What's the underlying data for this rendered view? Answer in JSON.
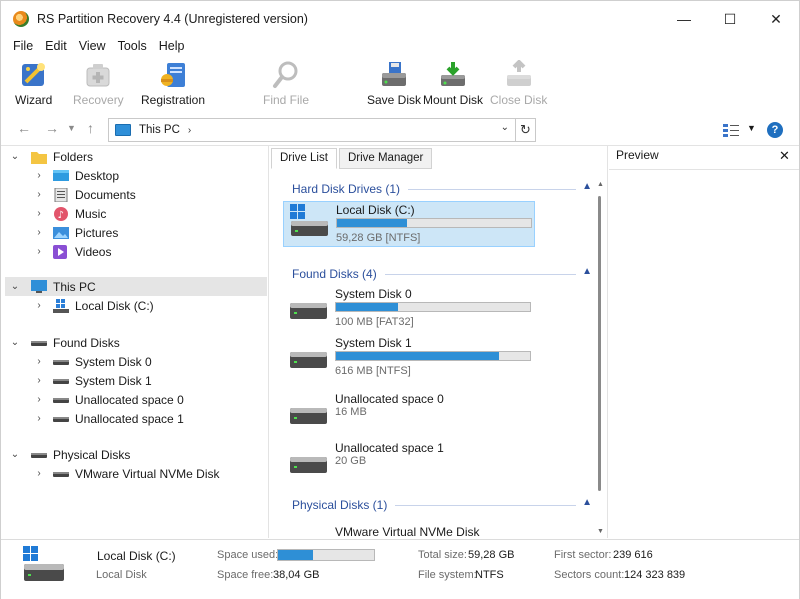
{
  "window": {
    "title": "RS Partition Recovery 4.4 (Unregistered version)",
    "controls": {
      "minimize": "—",
      "maximize": "☐",
      "close": "✕"
    }
  },
  "menu": [
    "File",
    "Edit",
    "View",
    "Tools",
    "Help"
  ],
  "toolbar": {
    "wizard": "Wizard",
    "recovery": "Recovery",
    "registration": "Registration",
    "find_file": "Find File",
    "save_disk": "Save Disk",
    "mount_disk": "Mount Disk",
    "close_disk": "Close Disk"
  },
  "address": {
    "path": "This PC",
    "separator": "›"
  },
  "tree": {
    "folders": "Folders",
    "desktop": "Desktop",
    "documents": "Documents",
    "music": "Music",
    "pictures": "Pictures",
    "videos": "Videos",
    "this_pc": "This PC",
    "local_disk": "Local Disk (C:)",
    "found_disks": "Found Disks",
    "system_disk_0": "System Disk 0",
    "system_disk_1": "System Disk 1",
    "unalloc_0": "Unallocated space 0",
    "unalloc_1": "Unallocated space 1",
    "physical_disks": "Physical Disks",
    "vmware": "VMware Virtual NVMe Disk"
  },
  "tabs": {
    "drive_list": "Drive List",
    "drive_manager": "Drive Manager"
  },
  "drive_list": {
    "hdd_section": "Hard Disk Drives (1)",
    "found_section": "Found Disks (4)",
    "physical_section": "Physical Disks (1)",
    "disks": [
      {
        "name": "Local Disk (C:)",
        "info": "59,28 GB [NTFS]",
        "used": 0.36
      },
      {
        "name": "System Disk 0",
        "info": "100 MB [FAT32]",
        "used": 0.32
      },
      {
        "name": "System Disk 1",
        "info": "616 MB [NTFS]",
        "used": 0.84
      },
      {
        "name": "Unallocated space 0",
        "info": "16 MB"
      },
      {
        "name": "Unallocated space 1",
        "info": "20 GB"
      },
      {
        "name": "VMware Virtual NVMe Disk"
      }
    ]
  },
  "preview": {
    "title": "Preview",
    "close": "✕"
  },
  "status": {
    "name": "Local Disk (C:)",
    "type": "Local Disk",
    "space_used_label": "Space used:",
    "space_used_fraction": 0.36,
    "space_free_label": "Space free:",
    "space_free": "38,04 GB",
    "total_size_label": "Total size:",
    "total_size": "59,28 GB",
    "file_system_label": "File system:",
    "file_system": "NTFS",
    "first_sector_label": "First sector:",
    "first_sector": "239 616",
    "sectors_count_label": "Sectors count:",
    "sectors_count": "124 323 839"
  },
  "colors": {
    "accent": "#2e8fd6",
    "section": "#2b4f9c",
    "selection": "#cde6f7"
  }
}
